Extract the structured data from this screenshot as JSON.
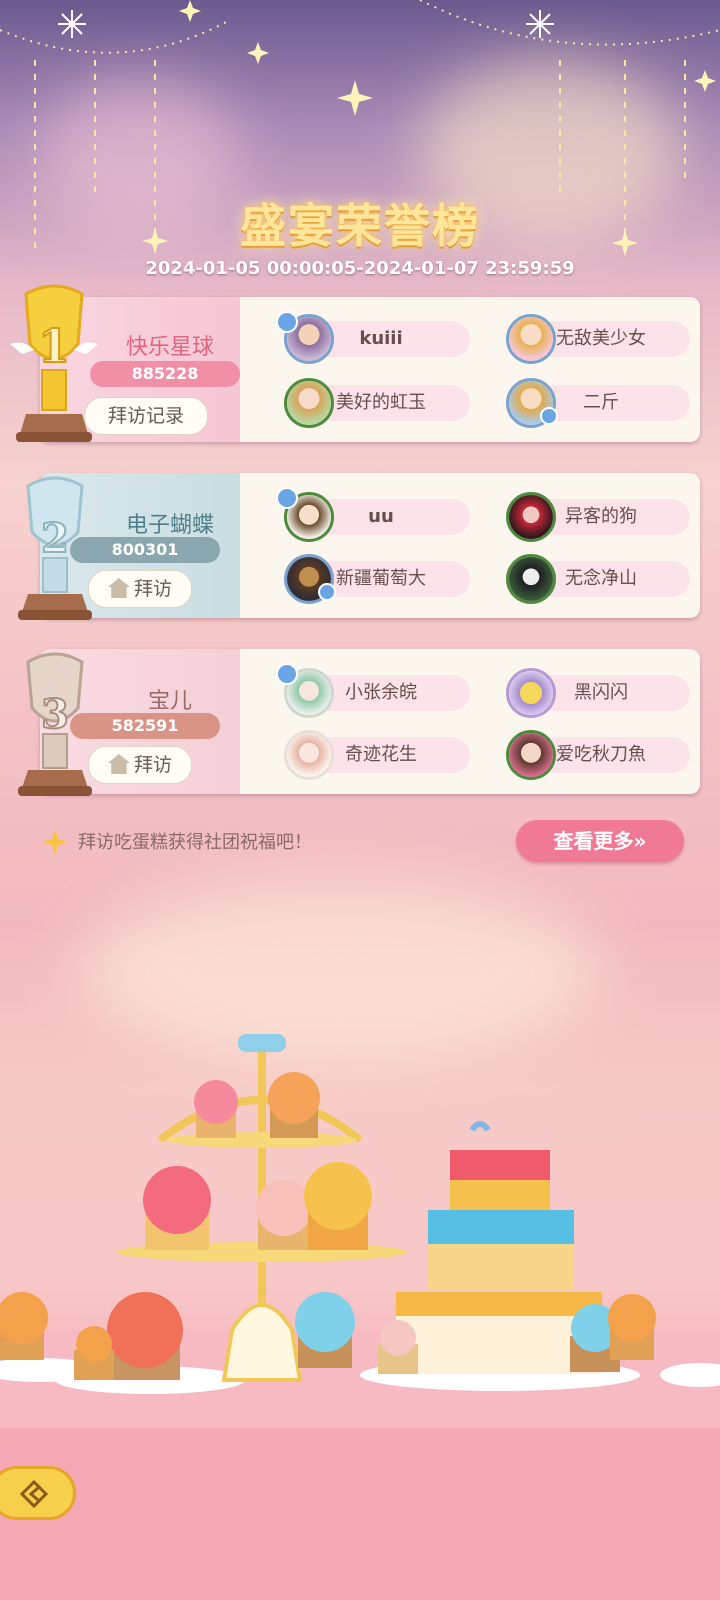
{
  "title": "盛宴荣誉榜",
  "date_range": "2024-01-05 00:00:05-2024-01-07 23:59:59",
  "rankings": [
    {
      "rank": "1",
      "club_name": "快乐星球",
      "score": "885228",
      "action_label": "拜访记录",
      "members": [
        "kuiii",
        "无敌美少女",
        "美好的虹玉",
        "二斤"
      ]
    },
    {
      "rank": "2",
      "club_name": "电子蝴蝶",
      "score": "800301",
      "action_label": "拜访",
      "members": [
        "uu",
        "异客的狗",
        "新疆葡萄大",
        "无念净山"
      ]
    },
    {
      "rank": "3",
      "club_name": "宝儿",
      "score": "582591",
      "action_label": "拜访",
      "members": [
        "小张余皖",
        "黑闪闪",
        "奇迹花生",
        "爱吃秋刀魚"
      ]
    }
  ],
  "hint": "拜访吃蛋糕获得社团祝福吧！",
  "more_button": "查看更多»",
  "colors": {
    "title_gold": "#ffe69a",
    "rank1_score": "#f08fa6",
    "rank2_score": "#8aa6ae",
    "rank3_score": "#d99486",
    "more_button": "#f07a95"
  },
  "icons": [
    "sparkle-icon",
    "trophy-gold-icon",
    "trophy-silver-icon",
    "trophy-bronze-icon",
    "house-icon",
    "admin-badge-icon",
    "back-arrow-icon"
  ]
}
